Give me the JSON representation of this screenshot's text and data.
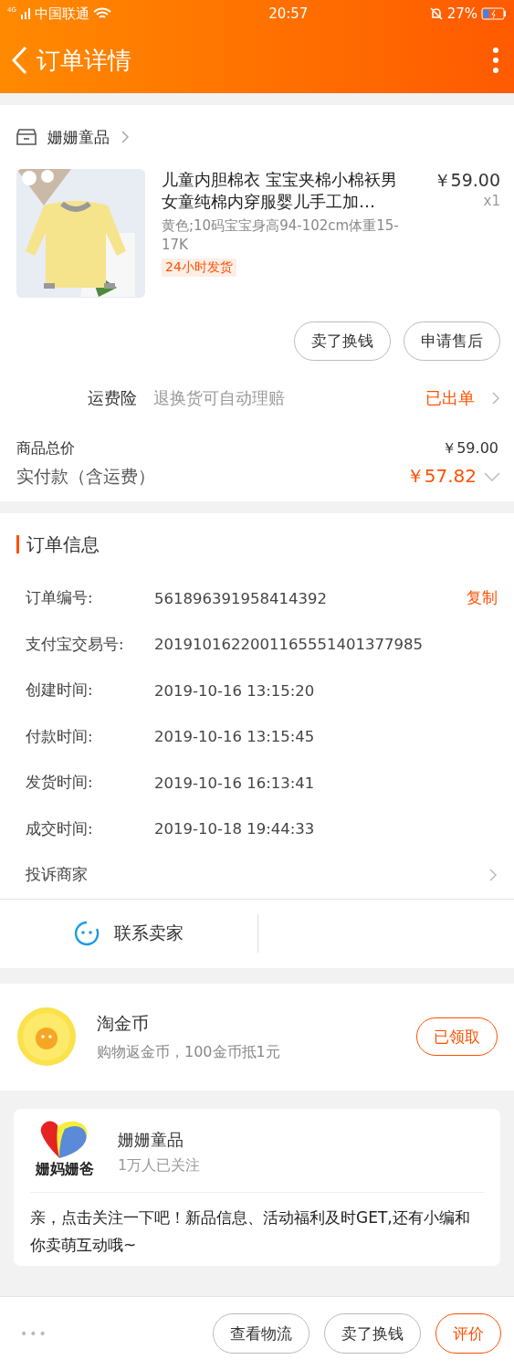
{
  "status_bar": {
    "network": "4G",
    "carrier": "中国联通",
    "time": "20:57",
    "battery": "27%"
  },
  "header": {
    "title": "订单详情"
  },
  "shop": {
    "name": "姗姗童品",
    "product": {
      "title": "儿童内胆棉衣 宝宝夹棉小棉袄男女童纯棉内穿服婴儿手工加…",
      "variant": "黄色;10码宝宝身高94-102cm体重15-17K",
      "badge": "24小时发货",
      "price": "￥59.00",
      "quantity": "x1"
    },
    "buttons": [
      "卖了换钱",
      "申请售后"
    ],
    "insurance": {
      "label": "运费险",
      "desc": "退换货可自动理赔",
      "status": "已出单"
    },
    "total": {
      "label": "商品总价",
      "value": "￥59.00"
    },
    "paid": {
      "label": "实付款（含运费）",
      "value": "￥57.82"
    }
  },
  "order_info": {
    "title": "订单信息",
    "fields": [
      {
        "label": "订单编号:",
        "value": "561896391958414392",
        "action": "复制"
      },
      {
        "label": "支付宝交易号:",
        "value": "2019101622001165551401377985"
      },
      {
        "label": "创建时间:",
        "value": "2019-10-16 13:15:20"
      },
      {
        "label": "付款时间:",
        "value": "2019-10-16 13:15:45"
      },
      {
        "label": "发货时间:",
        "value": "2019-10-16 16:13:41"
      },
      {
        "label": "成交时间:",
        "value": "2019-10-18 19:44:33"
      }
    ],
    "complaint": "投诉商家",
    "contact": "联系卖家"
  },
  "coins": {
    "title": "淘金币",
    "desc": "购物返金币，100金币抵1元",
    "button": "已领取"
  },
  "follow": {
    "name": "姗姗童品",
    "followers": "1万人已关注",
    "logo_text": "姗妈姗爸",
    "message": "亲，点击关注一下吧！新品信息、活动福利及时GET,还有小编和你卖萌互动哦~"
  },
  "bottom_bar": {
    "more": "•••",
    "buttons": [
      {
        "label": "查看物流",
        "kind": "plain"
      },
      {
        "label": "卖了换钱",
        "kind": "plain"
      },
      {
        "label": "评价",
        "kind": "primary"
      }
    ]
  }
}
